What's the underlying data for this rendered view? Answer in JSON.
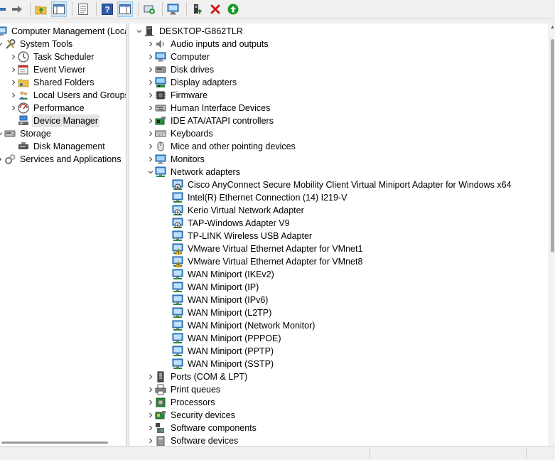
{
  "toolbar": {
    "buttons": [
      "back-icon",
      "forward-icon",
      "up-folder-icon",
      "show-hide-console-tree-icon",
      "properties-icon",
      "help-icon",
      "show-action-pane-icon",
      "update-driver-icon",
      "scan-hardware-icon",
      "enable-device-icon",
      "uninstall-device-icon",
      "update-green-icon"
    ]
  },
  "left_tree": {
    "root": "Computer Management (Local",
    "system_tools": "System Tools",
    "task_scheduler": "Task Scheduler",
    "event_viewer": "Event Viewer",
    "shared_folders": "Shared Folders",
    "local_users": "Local Users and Groups",
    "performance": "Performance",
    "device_manager": "Device Manager",
    "storage": "Storage",
    "disk_management": "Disk Management",
    "services": "Services and Applications"
  },
  "device_tree": {
    "computer_name": "DESKTOP-G862TLR",
    "categories_before": [
      {
        "label": "Audio inputs and outputs",
        "icon": "speaker-icon"
      },
      {
        "label": "Computer",
        "icon": "monitor-icon"
      },
      {
        "label": "Disk drives",
        "icon": "disk-icon"
      },
      {
        "label": "Display adapters",
        "icon": "display-adapter-icon"
      },
      {
        "label": "Firmware",
        "icon": "chip-icon"
      },
      {
        "label": "Human Interface Devices",
        "icon": "hid-icon"
      },
      {
        "label": "IDE ATA/ATAPI controllers",
        "icon": "controller-icon"
      },
      {
        "label": "Keyboards",
        "icon": "keyboard-icon"
      },
      {
        "label": "Mice and other pointing devices",
        "icon": "mouse-icon"
      },
      {
        "label": "Monitors",
        "icon": "monitor-icon"
      }
    ],
    "network_adapters": {
      "label": "Network adapters",
      "items": [
        {
          "label": "Cisco AnyConnect Secure Mobility Client Virtual Miniport Adapter for Windows x64",
          "icon": "network-adapter-disabled-icon"
        },
        {
          "label": "Intel(R) Ethernet Connection (14) I219-V",
          "icon": "network-adapter-icon"
        },
        {
          "label": "Kerio Virtual Network Adapter",
          "icon": "network-adapter-disabled-icon"
        },
        {
          "label": "TAP-Windows Adapter V9",
          "icon": "network-adapter-disabled-icon"
        },
        {
          "label": "TP-LINK Wireless USB Adapter",
          "icon": "network-adapter-icon"
        },
        {
          "label": "VMware Virtual Ethernet Adapter for VMnet1",
          "icon": "network-adapter-warning-icon"
        },
        {
          "label": "VMware Virtual Ethernet Adapter for VMnet8",
          "icon": "network-adapter-warning-icon"
        },
        {
          "label": "WAN Miniport (IKEv2)",
          "icon": "network-adapter-icon"
        },
        {
          "label": "WAN Miniport (IP)",
          "icon": "network-adapter-icon"
        },
        {
          "label": "WAN Miniport (IPv6)",
          "icon": "network-adapter-icon"
        },
        {
          "label": "WAN Miniport (L2TP)",
          "icon": "network-adapter-icon"
        },
        {
          "label": "WAN Miniport (Network Monitor)",
          "icon": "network-adapter-icon"
        },
        {
          "label": "WAN Miniport (PPPOE)",
          "icon": "network-adapter-icon"
        },
        {
          "label": "WAN Miniport (PPTP)",
          "icon": "network-adapter-icon"
        },
        {
          "label": "WAN Miniport (SSTP)",
          "icon": "network-adapter-icon"
        }
      ]
    },
    "categories_after": [
      {
        "label": "Ports (COM & LPT)",
        "icon": "port-icon"
      },
      {
        "label": "Print queues",
        "icon": "printer-icon"
      },
      {
        "label": "Processors",
        "icon": "processor-icon"
      },
      {
        "label": "Security devices",
        "icon": "security-device-icon"
      },
      {
        "label": "Software components",
        "icon": "software-component-icon"
      },
      {
        "label": "Software devices",
        "icon": "software-device-icon"
      }
    ]
  },
  "colors": {
    "selection": "#e5e5e5",
    "monitor_blue": "#3d8fd8",
    "warning_yellow": "#f2c100",
    "delete_red": "#d0121a",
    "update_green": "#129c24"
  }
}
